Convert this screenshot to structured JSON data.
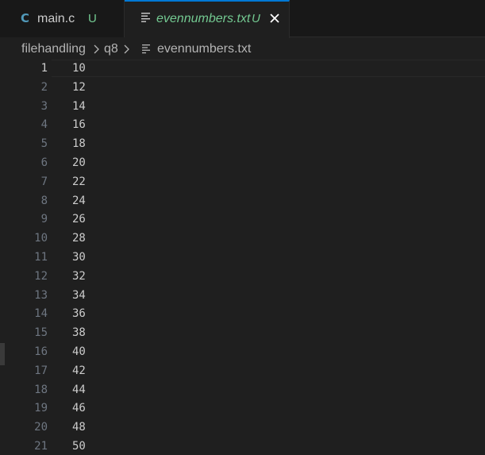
{
  "tabs": [
    {
      "icon": "C",
      "label": "main.c",
      "status": "U",
      "active": false
    },
    {
      "label": "evennumbers.txt",
      "status": "U",
      "active": true
    }
  ],
  "breadcrumb": [
    "filehandling",
    "q8",
    "evennumbers.txt"
  ],
  "colors": {
    "background": "#1f1f1f",
    "tabbar": "#181818",
    "active_tab_border": "#0078d4",
    "modified": "#73c991",
    "c_icon": "#519aba",
    "line_number": "#6e7681",
    "text": "#cccccc"
  },
  "icons": {
    "c_file": "c-language-icon",
    "text_file": "text-file-icon",
    "close": "close-icon",
    "separator": "chevron-right-icon"
  },
  "active_line": 1,
  "lines": [
    {
      "n": "1",
      "text": "10"
    },
    {
      "n": "2",
      "text": "12"
    },
    {
      "n": "3",
      "text": "14"
    },
    {
      "n": "4",
      "text": "16"
    },
    {
      "n": "5",
      "text": "18"
    },
    {
      "n": "6",
      "text": "20"
    },
    {
      "n": "7",
      "text": "22"
    },
    {
      "n": "8",
      "text": "24"
    },
    {
      "n": "9",
      "text": "26"
    },
    {
      "n": "10",
      "text": "28"
    },
    {
      "n": "11",
      "text": "30"
    },
    {
      "n": "12",
      "text": "32"
    },
    {
      "n": "13",
      "text": "34"
    },
    {
      "n": "14",
      "text": "36"
    },
    {
      "n": "15",
      "text": "38"
    },
    {
      "n": "16",
      "text": "40"
    },
    {
      "n": "17",
      "text": "42"
    },
    {
      "n": "18",
      "text": "44"
    },
    {
      "n": "19",
      "text": "46"
    },
    {
      "n": "20",
      "text": "48"
    },
    {
      "n": "21",
      "text": "50"
    }
  ]
}
